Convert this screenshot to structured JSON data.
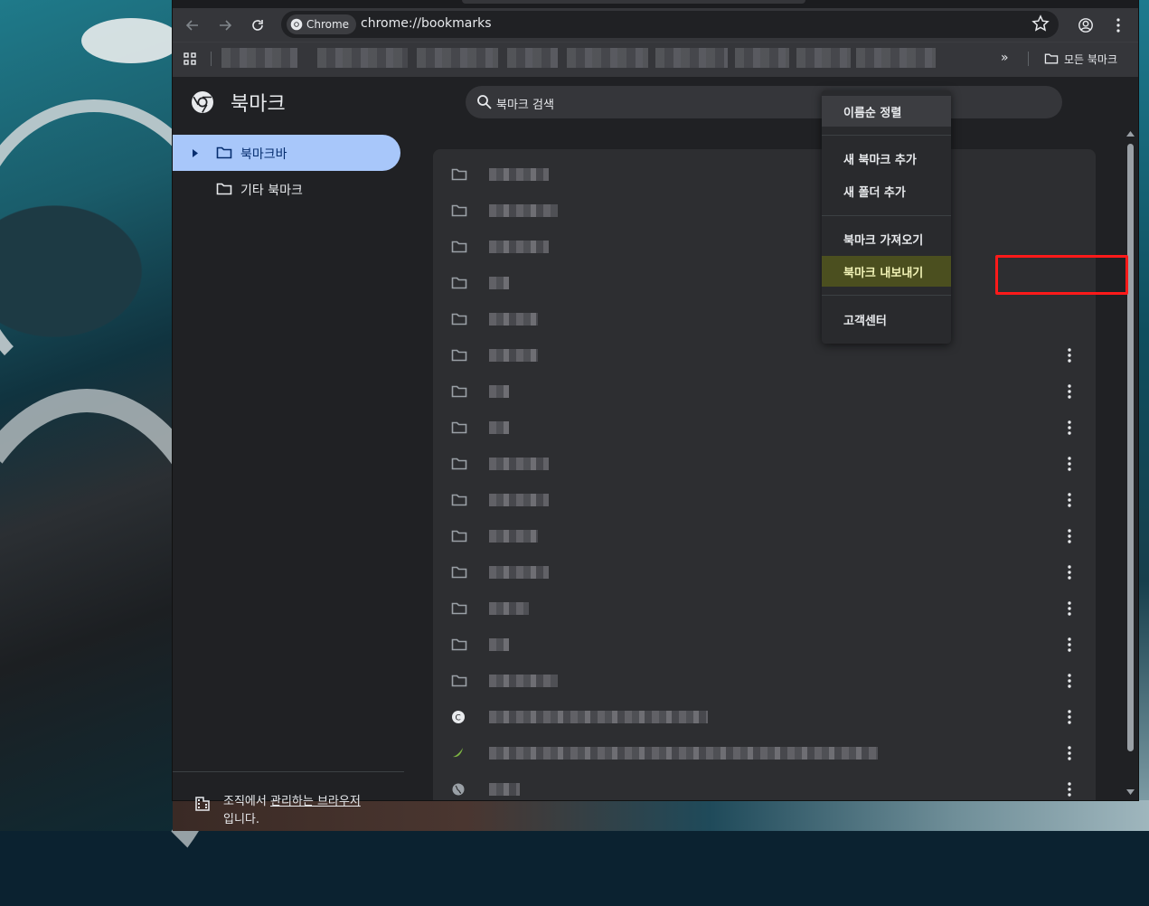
{
  "toolbar": {
    "chip_label": "Chrome",
    "url": "chrome://bookmarks"
  },
  "bookmarks_bar": {
    "all_bookmarks_label": "모든 북마크"
  },
  "page": {
    "title": "북마크",
    "search_placeholder": "북마크 검색"
  },
  "sidebar": {
    "items": [
      {
        "label": "북마크바",
        "active": true
      },
      {
        "label": "기타 북마크",
        "active": false
      }
    ],
    "footer": {
      "prefix": "조직에서 ",
      "link": "관리하는 브라우저",
      "suffix": "입니다."
    }
  },
  "menu": {
    "items": [
      {
        "label": "이름순 정렬"
      },
      {
        "label": "새 북마크 추가"
      },
      {
        "label": "새 폴더 추가"
      },
      {
        "label": "북마크 가져오기"
      },
      {
        "label": "북마크 내보내기"
      },
      {
        "label": "고객센터"
      }
    ]
  },
  "colors": {
    "active_item_bg": "#a8c7fa",
    "highlight_box": "#ff1a1a"
  }
}
